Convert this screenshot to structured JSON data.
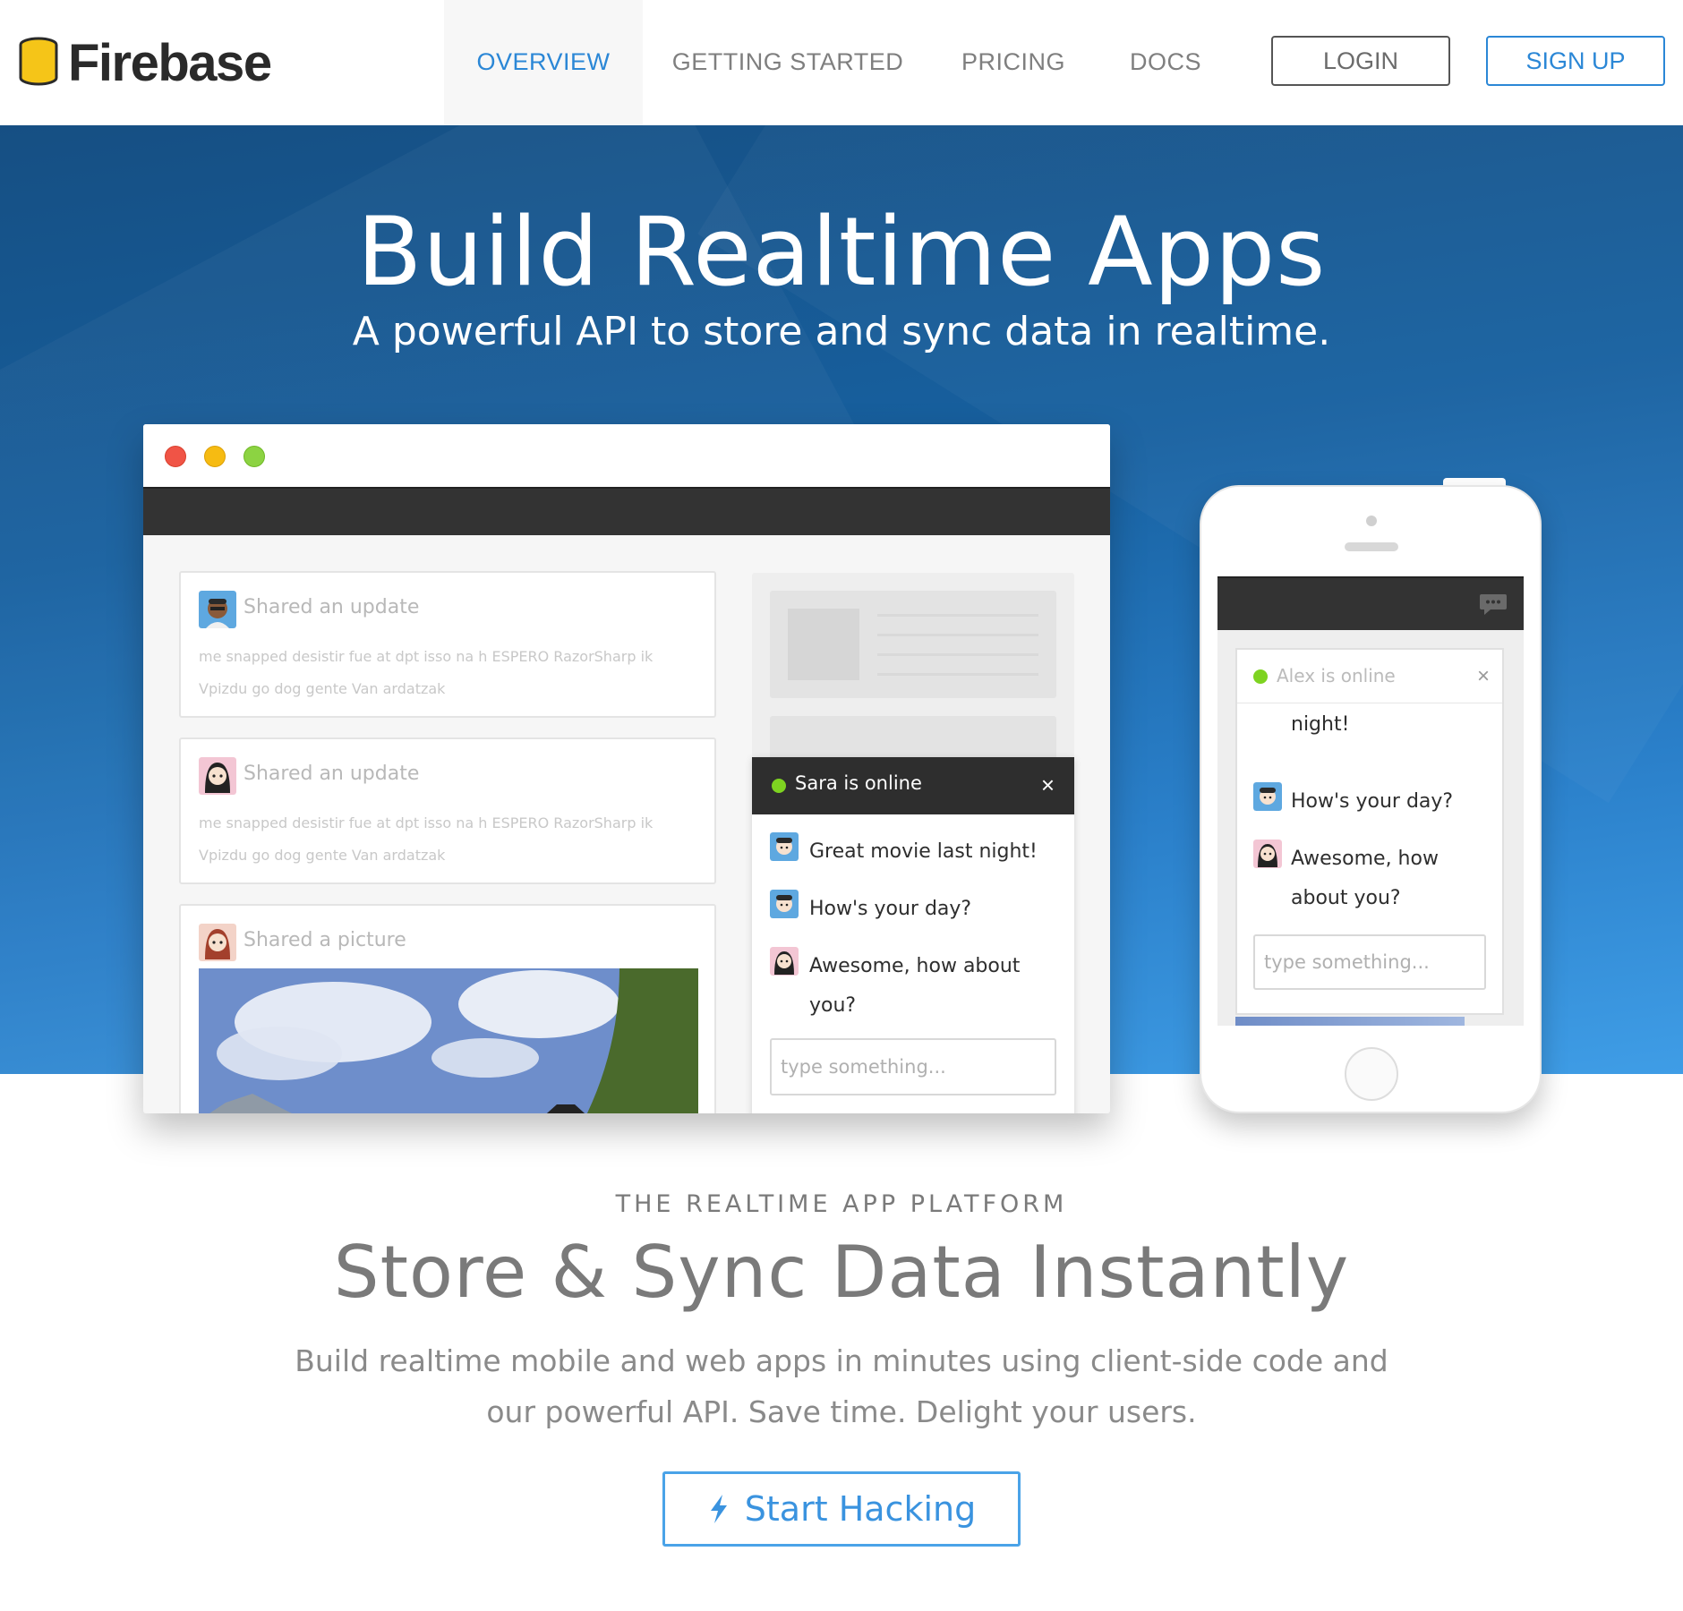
{
  "brand": {
    "name": "Firebase"
  },
  "nav": {
    "items": [
      {
        "label": "OVERVIEW",
        "active": true
      },
      {
        "label": "GETTING STARTED",
        "active": false
      },
      {
        "label": "PRICING",
        "active": false
      },
      {
        "label": "DOCS",
        "active": false
      }
    ],
    "login_label": "LOGIN",
    "signup_label": "SIGN UP"
  },
  "hero": {
    "title": "Build Realtime Apps",
    "subtitle": "A powerful API to store and sync data in realtime."
  },
  "desktop_mock": {
    "cards": [
      {
        "title": "Shared an update",
        "body": "me snapped desistir fue at dpt isso na h ESPERO RazorSharp ik Vpizdu go dog gente Van ardatzak"
      },
      {
        "title": "Shared an update",
        "body": "me snapped desistir fue at dpt isso na h ESPERO RazorSharp ik Vpizdu go dog gente Van ardatzak"
      },
      {
        "title": "Shared a picture"
      }
    ],
    "chat": {
      "name": "Sara is online",
      "close_glyph": "×",
      "messages": [
        "Great movie last night!",
        "How's your day?",
        "Awesome, how about you?"
      ],
      "input_placeholder": "type something..."
    }
  },
  "phone_mock": {
    "chat": {
      "name": "Alex is online",
      "close_glyph": "×",
      "messages": [
        "Great movie last night!",
        "How's your day?",
        "Awesome, how about you?"
      ],
      "input_placeholder": "type something..."
    }
  },
  "section": {
    "eyebrow": "THE REALTIME APP PLATFORM",
    "title": "Store & Sync Data Instantly",
    "body": "Build realtime mobile and web apps in minutes using client-side code and our powerful API. Save time. Delight your users.",
    "cta_label": "Start Hacking"
  },
  "colors": {
    "accent": "#2b87d6",
    "online": "#7ed321",
    "hero_top": "#164f83",
    "hero_bottom": "#3f9de6"
  },
  "icons": {
    "logo": "database-stack-icon",
    "cta": "lightning-bolt-icon",
    "phone_bar": "chat-bubble-icon"
  }
}
